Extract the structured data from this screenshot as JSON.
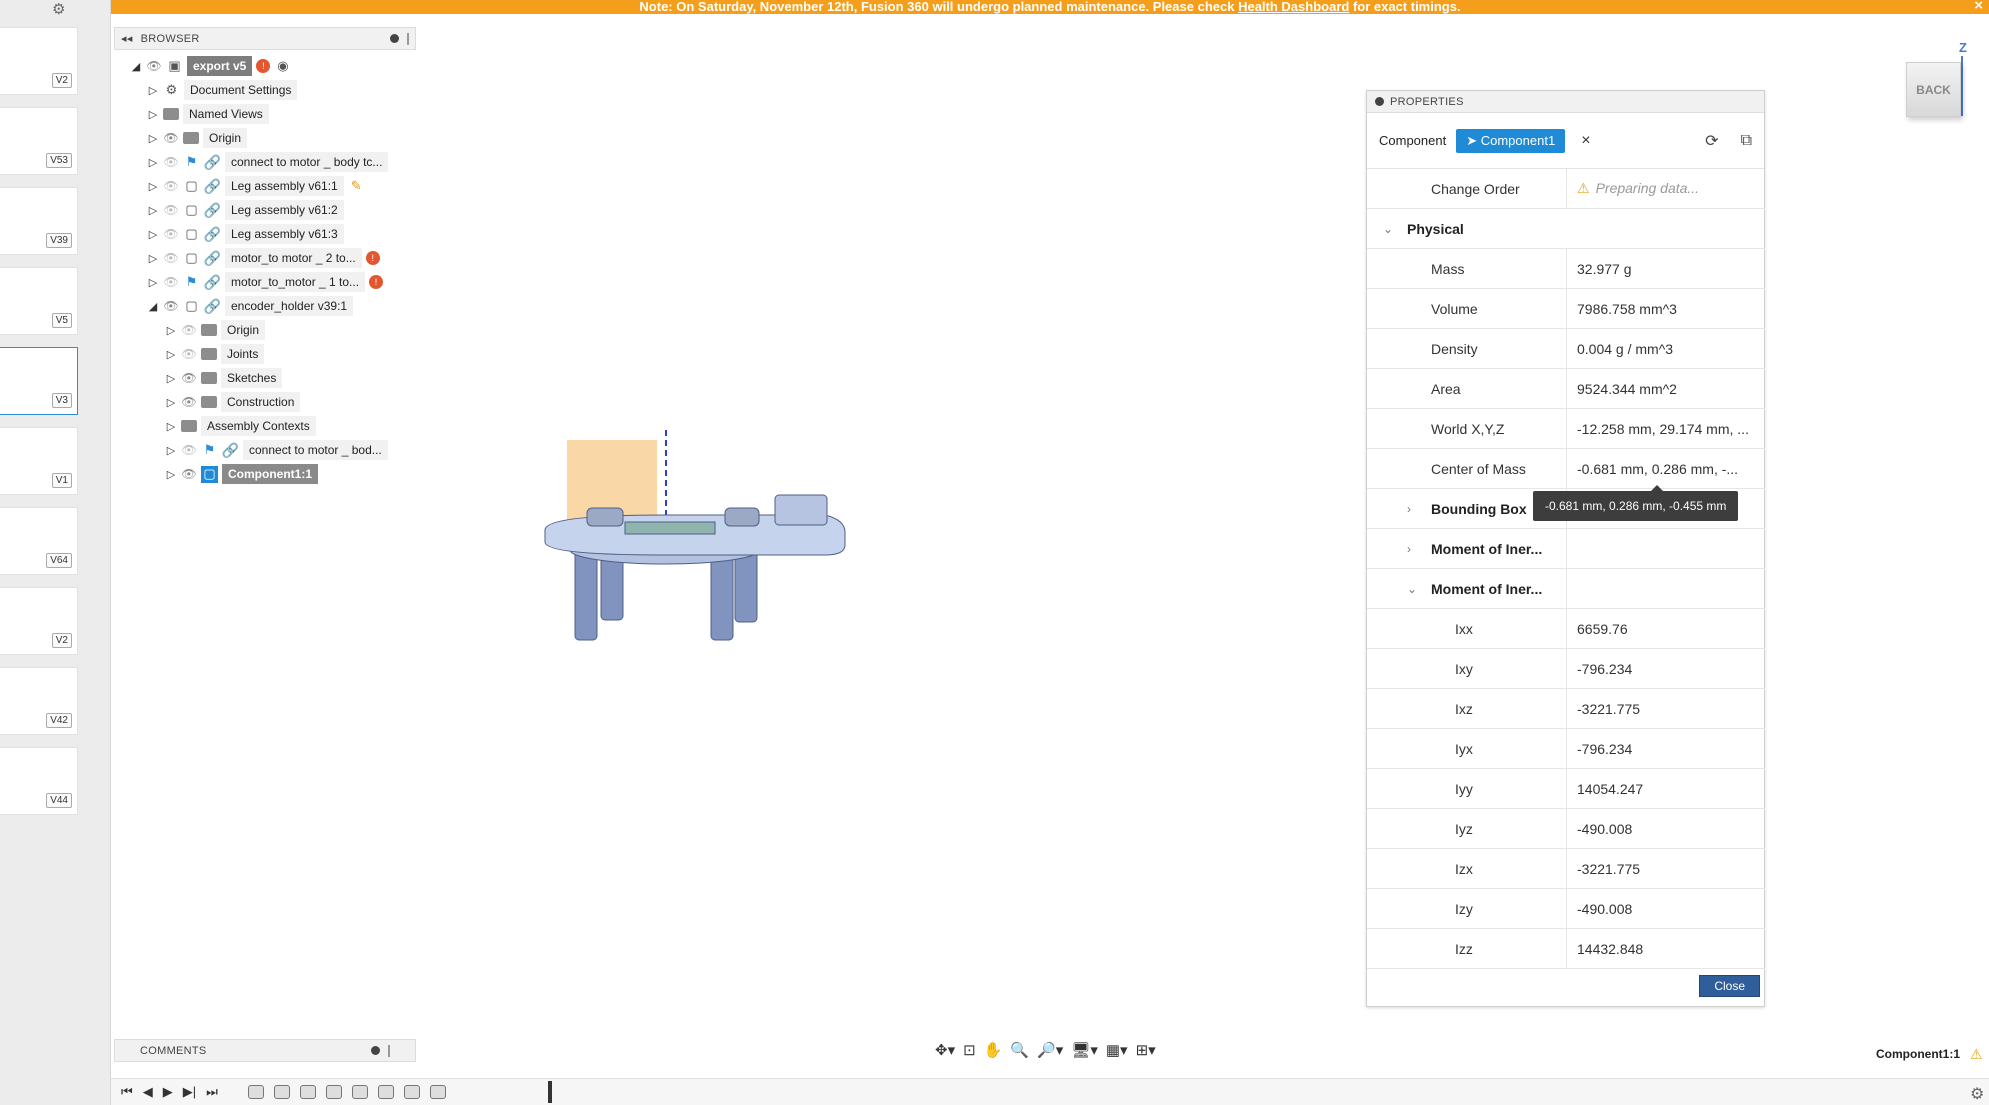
{
  "banner": {
    "prefix": "Note: On Saturday, November 12th, Fusion 360 will undergo planned maintenance. Please check ",
    "link": "Health Dashboard",
    "suffix": " for exact timings.",
    "close": "×"
  },
  "versions": [
    "V2",
    "V53",
    "V39",
    "V5",
    "V3",
    "V1",
    "V64",
    "V2",
    "V42",
    "V44"
  ],
  "browser": {
    "title": "BROWSER",
    "root": "export v5",
    "items": [
      {
        "label": "Document Settings"
      },
      {
        "label": "Named Views"
      },
      {
        "label": "Origin"
      },
      {
        "label": "connect to motor _ body tc..."
      },
      {
        "label": "Leg assembly v61:1"
      },
      {
        "label": "Leg assembly v61:2"
      },
      {
        "label": "Leg assembly v61:3"
      },
      {
        "label": "motor_to motor _ 2 to..."
      },
      {
        "label": "motor_to_motor _ 1 to..."
      },
      {
        "label": "encoder_holder v39:1"
      },
      {
        "label": "Origin"
      },
      {
        "label": "Joints"
      },
      {
        "label": "Sketches"
      },
      {
        "label": "Construction"
      },
      {
        "label": "Assembly Contexts"
      },
      {
        "label": "connect to motor _ bod..."
      },
      {
        "label": "Component1:1"
      }
    ]
  },
  "properties": {
    "title": "PROPERTIES",
    "component_label": "Component",
    "component_chip": "Component1",
    "close_x": "×",
    "rows": [
      {
        "key": "Change Order",
        "value": "Preparing data..."
      },
      {
        "key": "Physical",
        "value": ""
      },
      {
        "key": "Mass",
        "value": "32.977 g"
      },
      {
        "key": "Volume",
        "value": "7986.758 mm^3"
      },
      {
        "key": "Density",
        "value": "0.004 g / mm^3"
      },
      {
        "key": "Area",
        "value": "9524.344 mm^2"
      },
      {
        "key": "World X,Y,Z",
        "value": "-12.258 mm, 29.174 mm, ..."
      },
      {
        "key": "Center of Mass",
        "value": "-0.681 mm, 0.286 mm, -..."
      },
      {
        "key": "Bounding Box",
        "value": ""
      },
      {
        "key": "Moment of Iner...",
        "value": ""
      },
      {
        "key": "Moment of Iner...",
        "value": ""
      },
      {
        "key": "Ixx",
        "value": "6659.76"
      },
      {
        "key": "Ixy",
        "value": "-796.234"
      },
      {
        "key": "Ixz",
        "value": "-3221.775"
      },
      {
        "key": "Iyx",
        "value": "-796.234"
      },
      {
        "key": "Iyy",
        "value": "14054.247"
      },
      {
        "key": "Iyz",
        "value": "-490.008"
      },
      {
        "key": "Izx",
        "value": "-3221.775"
      },
      {
        "key": "Izy",
        "value": "-490.008"
      },
      {
        "key": "Izz",
        "value": "14432.848"
      }
    ],
    "tooltip": "-0.681 mm, 0.286 mm, -0.455 mm",
    "close_button": "Close"
  },
  "comments": {
    "title": "COMMENTS"
  },
  "viewcube": {
    "face": "BACK",
    "axis": "Z"
  },
  "status": {
    "component": "Component1:1"
  },
  "colors": {
    "banner": "#f59e1b",
    "selection": "#1f8ad6",
    "close_button": "#2f5e9a"
  }
}
